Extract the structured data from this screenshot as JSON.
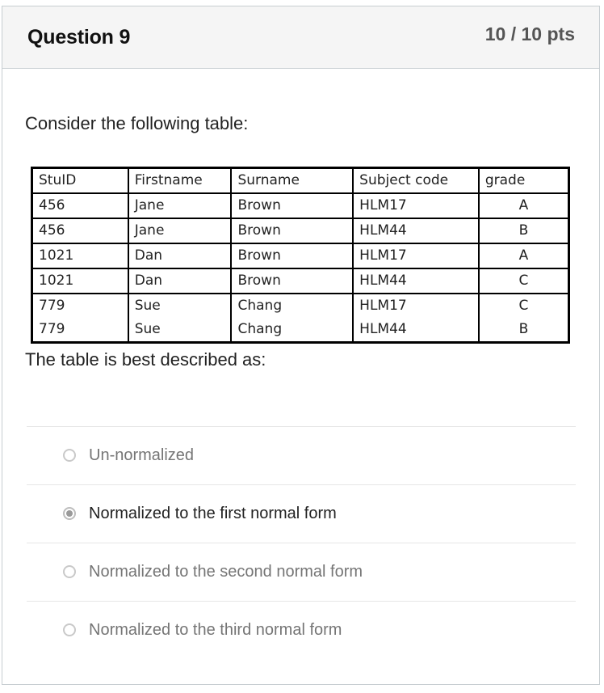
{
  "question": {
    "title": "Question 9",
    "points": "10 / 10 pts",
    "prompt": "Consider the following table:",
    "description": "The table is best described as:"
  },
  "table": {
    "headers": [
      "StuID",
      "Firstname",
      "Surname",
      "Subject code",
      "grade"
    ],
    "rows": [
      [
        "456",
        "Jane",
        "Brown",
        "HLM17",
        "A"
      ],
      [
        "456",
        "Jane",
        "Brown",
        "HLM44",
        "B"
      ],
      [
        "1021",
        "Dan",
        "Brown",
        "HLM17",
        "A"
      ],
      [
        "1021",
        "Dan",
        "Brown",
        "HLM44",
        "C"
      ],
      [
        "779",
        "Sue",
        "Chang",
        "HLM17",
        "C"
      ],
      [
        "779",
        "Sue",
        "Chang",
        "HLM44",
        "B"
      ]
    ]
  },
  "answers": {
    "selected_index": 1,
    "options": [
      "Un-normalized",
      "Normalized to the first normal form",
      "Normalized to the second normal form",
      "Normalized to the third normal form"
    ]
  },
  "colors": {
    "header_bg": "#f5f5f5",
    "border": "#c7cdd1",
    "selected_text": "#222222",
    "unselected_text": "#757575"
  }
}
